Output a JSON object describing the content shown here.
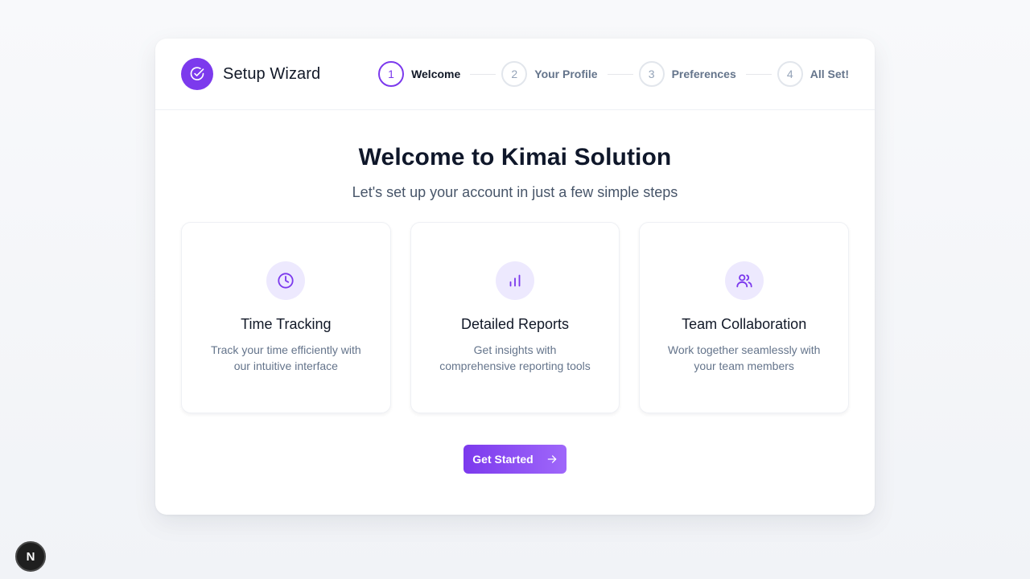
{
  "header": {
    "brand_title": "Setup Wizard",
    "brand_icon": "check-circle-icon",
    "steps": [
      {
        "number": "1",
        "label": "Welcome",
        "active": true
      },
      {
        "number": "2",
        "label": "Your Profile",
        "active": false
      },
      {
        "number": "3",
        "label": "Preferences",
        "active": false
      },
      {
        "number": "4",
        "label": "All Set!",
        "active": false
      }
    ]
  },
  "main": {
    "title": "Welcome to Kimai Solution",
    "subtitle": "Let's set up your account in just a few simple steps",
    "features": [
      {
        "icon": "clock-icon",
        "title": "Time Tracking",
        "description": "Track your time efficiently with our intuitive interface"
      },
      {
        "icon": "bar-chart-icon",
        "title": "Detailed Reports",
        "description": "Get insights with comprehensive reporting tools"
      },
      {
        "icon": "users-icon",
        "title": "Team Collaboration",
        "description": "Work together seamlessly with your team members"
      }
    ],
    "cta_label": "Get Started"
  },
  "dev_badge": "N",
  "colors": {
    "accent": "#7c3aed",
    "accent_light": "#ede9fe",
    "text_dark": "#0f172a",
    "text_muted": "#64748b"
  }
}
